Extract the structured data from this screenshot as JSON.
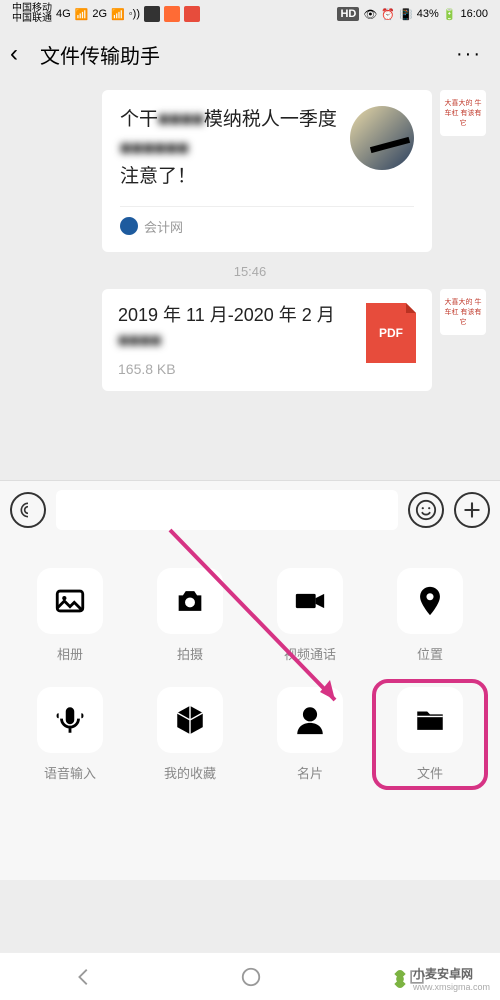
{
  "status": {
    "carrier1": "中国移动",
    "carrier2": "中国联通",
    "net": "4G",
    "net2": "2G",
    "hd": "HD",
    "battery": "43%",
    "time": "16:00"
  },
  "header": {
    "title": "文件传输助手"
  },
  "chat": {
    "article": {
      "title_p1": "个干",
      "title_blur1": "■■■■",
      "title_p2": "模纳税人一季度",
      "title_blur2": "■■■■■■",
      "title_p3": "注意了！",
      "source": "会计网"
    },
    "timestamp": "15:46",
    "file": {
      "name_p1": "2019 年 11 月-2020 年 2 月",
      "name_blur": "■■■■",
      "size": "165.8 KB",
      "type": "PDF"
    },
    "avatar_text": "大喜大的\n牛车杠\n有该有它"
  },
  "panel": {
    "items": [
      {
        "label": "相册"
      },
      {
        "label": "拍摄"
      },
      {
        "label": "视频通话"
      },
      {
        "label": "位置"
      },
      {
        "label": "语音输入"
      },
      {
        "label": "我的收藏"
      },
      {
        "label": "名片"
      },
      {
        "label": "文件"
      }
    ]
  },
  "watermark": {
    "brand": "小麦安卓网",
    "url": "www.xmsigma.com"
  }
}
